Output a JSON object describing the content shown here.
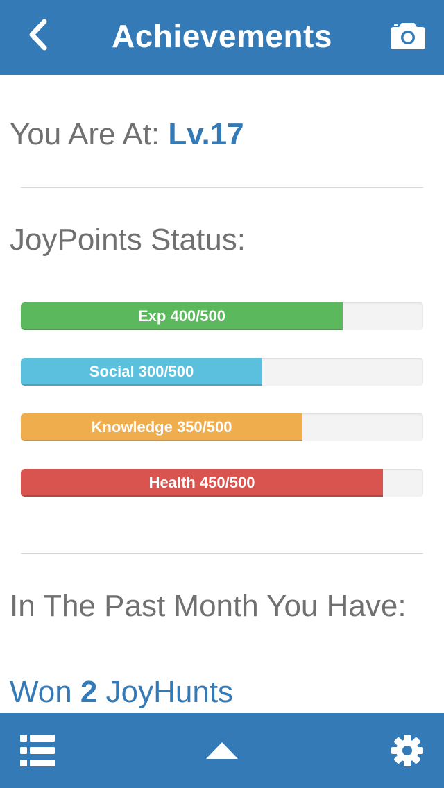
{
  "header": {
    "title": "Achievements",
    "back_icon": "chevron-left-icon",
    "camera_icon": "camera-icon"
  },
  "level": {
    "label": "You Are At:",
    "value": "Lv.17"
  },
  "joypoints": {
    "heading": "JoyPoints Status:",
    "bars": [
      {
        "label": "Exp 400/500",
        "current": 400,
        "max": 500,
        "color": "#5cb85c"
      },
      {
        "label": "Social 300/500",
        "current": 300,
        "max": 500,
        "color": "#5bc0de"
      },
      {
        "label": "Knowledge 350/500",
        "current": 350,
        "max": 500,
        "color": "#f0ad4e"
      },
      {
        "label": "Health 450/500",
        "current": 450,
        "max": 500,
        "color": "#d9534f"
      }
    ]
  },
  "past_month": {
    "heading": "In The Past Month You Have:",
    "won_prefix": "Won",
    "won_count": "2",
    "won_suffix": "JoyHunts"
  },
  "tabbar": {
    "list_icon": "list-icon",
    "up_icon": "triangle-up-icon",
    "settings_icon": "gear-icon"
  },
  "colors": {
    "primary": "#337ab7",
    "text_gray": "#707070"
  }
}
